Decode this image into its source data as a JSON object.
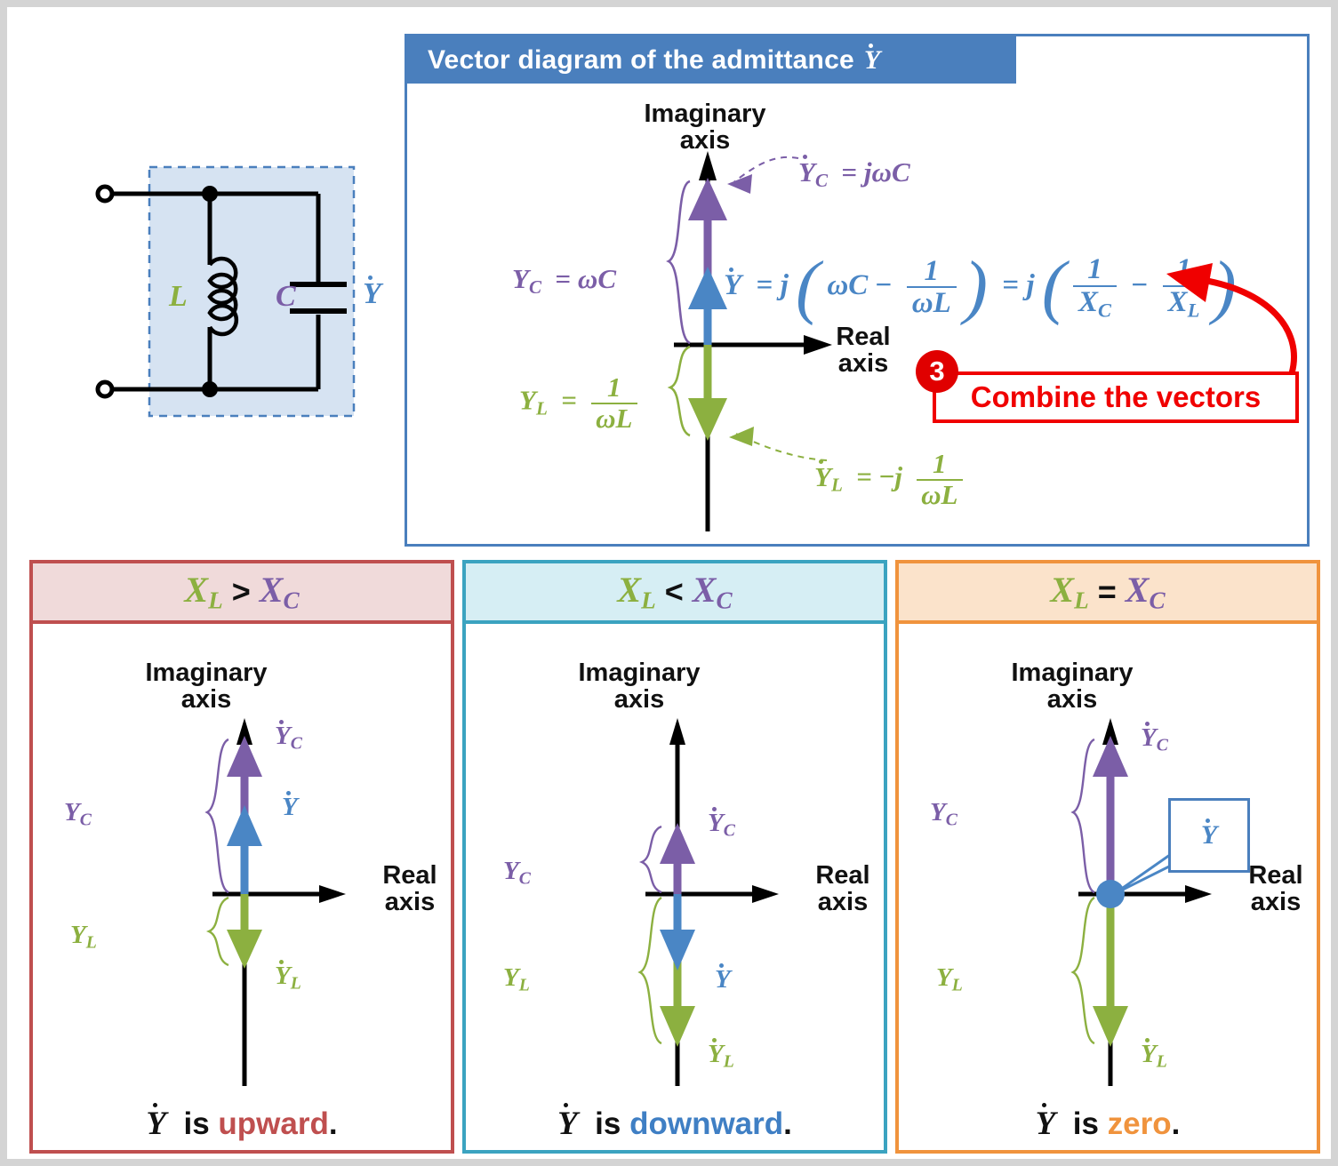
{
  "colors": {
    "blue": "#4a86c5",
    "header_blue": "#4a7fbd",
    "purple": "#7b5ea7",
    "green": "#8cb040",
    "red": "#f00000",
    "case1_border": "#bf4f4f",
    "case1_fill": "#f0dada",
    "case2_border": "#3ba3c0",
    "case2_fill": "#d6eef4",
    "case3_border": "#f0933d",
    "case3_fill": "#fbe3cb",
    "circuit_fill": "#d6e3f2"
  },
  "circuit": {
    "inductor_label": "L",
    "capacitor_label": "C",
    "admittance_label": "Y"
  },
  "main_panel": {
    "title_prefix": "Vector diagram of the admittance",
    "title_symbol": "Y",
    "imaginary_axis": "Imaginary\naxis",
    "imaginary_axis_line1": "Imaginary",
    "imaginary_axis_line2": "axis",
    "real_axis_line1": "Real",
    "real_axis_line2": "axis",
    "yc_magnitude": "Y_C = ωC",
    "yl_magnitude": "Y_L = 1/ωL",
    "yc_vector_label": "Y_C = jωC",
    "yl_vector_label": "Y_L = −j 1/ωL",
    "main_equation": "Y = j(ωC − 1/ωL) = j(1/X_C − 1/X_L)"
  },
  "combine_callout": {
    "step_number": "3",
    "label": "Combine the vectors"
  },
  "cases": [
    {
      "id": "case1",
      "head_left": "X",
      "head_left_sub": "L",
      "operator": ">",
      "head_right": "X",
      "head_right_sub": "C",
      "imaginary_axis_line1": "Imaginary",
      "imaginary_axis_line2": "axis",
      "real_axis_line1": "Real",
      "real_axis_line2": "axis",
      "yc_brace": "Y_C",
      "yl_brace": "Y_L",
      "yc_vector": "Y_C",
      "yl_vector": "Y_L",
      "y_vector": "Y",
      "caption_prefix": "Y is",
      "caption_word": "upward",
      "caption_suffix": "."
    },
    {
      "id": "case2",
      "head_left": "X",
      "head_left_sub": "L",
      "operator": "<",
      "head_right": "X",
      "head_right_sub": "C",
      "imaginary_axis_line1": "Imaginary",
      "imaginary_axis_line2": "axis",
      "real_axis_line1": "Real",
      "real_axis_line2": "axis",
      "yc_brace": "Y_C",
      "yl_brace": "Y_L",
      "yc_vector": "Y_C",
      "yl_vector": "Y_L",
      "y_vector": "Y",
      "caption_prefix": "Y is",
      "caption_word": "downward",
      "caption_suffix": "."
    },
    {
      "id": "case3",
      "head_left": "X",
      "head_left_sub": "L",
      "operator": "=",
      "head_right": "X",
      "head_right_sub": "C",
      "imaginary_axis_line1": "Imaginary",
      "imaginary_axis_line2": "axis",
      "real_axis_line1": "Real",
      "real_axis_line2": "axis",
      "yc_brace": "Y_C",
      "yl_brace": "Y_L",
      "yc_vector": "Y_C",
      "yl_vector": "Y_L",
      "y_vector": "Y",
      "caption_prefix": "Y is",
      "caption_word": "zero",
      "caption_suffix": "."
    }
  ],
  "symbols": {
    "Y": "Y",
    "X": "X",
    "C": "C",
    "L": "L",
    "j": "j",
    "omega": "ω",
    "one": "1",
    "equals": "=",
    "minus": "−"
  }
}
